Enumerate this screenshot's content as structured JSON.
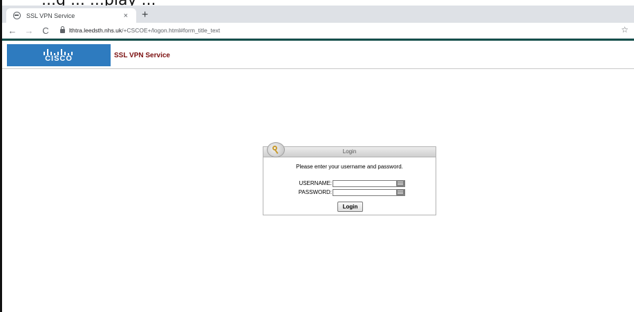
{
  "caption": "...g ... ...play ...",
  "browser": {
    "tab_title": "SSL VPN Service",
    "tab_close": "×",
    "new_tab": "+",
    "nav_back": "←",
    "nav_forward": "→",
    "nav_reload": "C",
    "url_host": "lthtra.leedsth.nhs.uk",
    "url_rest": "/+CSCOE+/logon.html#form_title_text",
    "star": "☆"
  },
  "header": {
    "logo_text": "CISCO",
    "service_title": "SSL VPN Service"
  },
  "login": {
    "title": "Login",
    "prompt": "Please enter your username and password.",
    "username_label": "USERNAME:",
    "username_value": "",
    "password_label": "PASSWORD:",
    "password_value": "",
    "submit_label": "Login"
  },
  "colors": {
    "brand_blue": "#2e7bbf",
    "service_red": "#7a0e0e",
    "separator_teal": "#134e4a"
  }
}
